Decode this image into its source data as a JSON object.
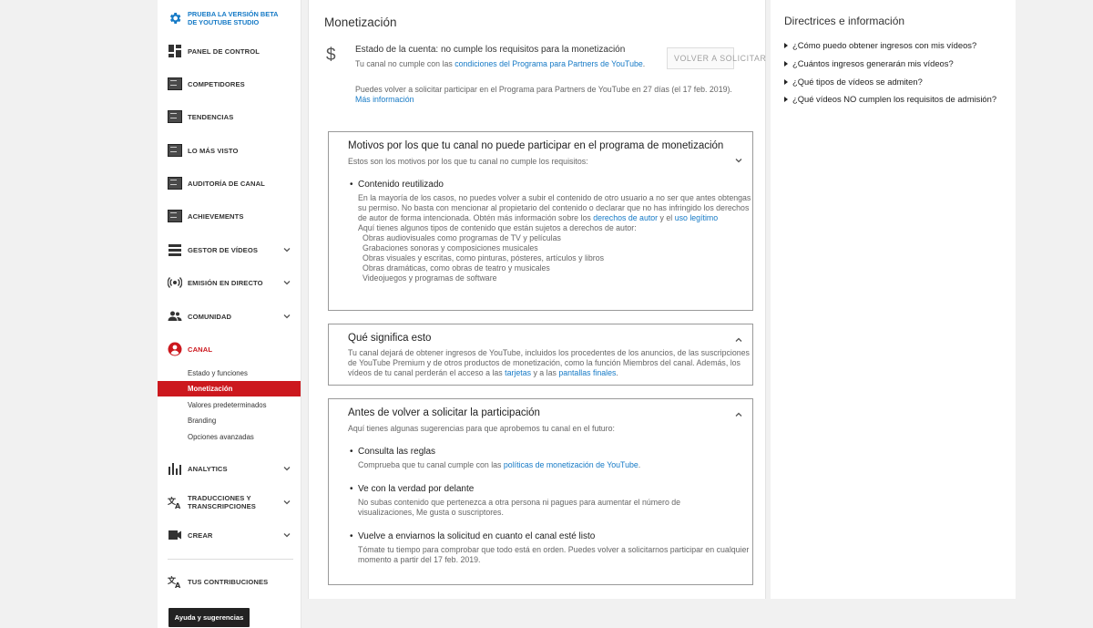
{
  "sidebar": {
    "beta_label": "PRUEBA LA VERSIÓN BETA DE YOUTUBE STUDIO",
    "items": [
      {
        "label": "PANEL DE CONTROL",
        "icon": "dashboard-icon"
      },
      {
        "label": "COMPETIDORES",
        "icon": "extension-icon"
      },
      {
        "label": "TENDENCIAS",
        "icon": "extension-icon"
      },
      {
        "label": "LO MÁS VISTO",
        "icon": "extension-icon"
      },
      {
        "label": "AUDITORÍA DE CANAL",
        "icon": "extension-icon"
      },
      {
        "label": "ACHIEVEMENTS",
        "icon": "extension-icon"
      },
      {
        "label": "GESTOR DE VÍDEOS",
        "icon": "video-manager-icon"
      },
      {
        "label": "EMISIÓN EN DIRECTO",
        "icon": "live-icon"
      },
      {
        "label": "COMUNIDAD",
        "icon": "community-icon"
      },
      {
        "label": "CANAL",
        "icon": "channel-icon"
      },
      {
        "label": "ANALYTICS",
        "icon": "analytics-icon"
      },
      {
        "label": "TRADUCCIONES Y TRANSCRIPCIONES",
        "icon": "translate-icon"
      },
      {
        "label": "CREAR",
        "icon": "create-icon"
      },
      {
        "label": "TUS CONTRIBUCIONES",
        "icon": "translate-icon"
      }
    ],
    "sub_items": [
      "Estado y funciones",
      "Monetización",
      "Valores predeterminados",
      "Branding",
      "Opciones avanzadas"
    ],
    "help_button": "Ayuda y sugerencias",
    "accent_color": "#cc181e"
  },
  "main": {
    "title": "Monetización",
    "status_title": "Estado de la cuenta: no cumple los requisitos para la monetización",
    "status_sub_prefix": "Tu canal no cumple con las ",
    "status_sub_link": "condiciones del Programa para Partners de YouTube",
    "status_sub_suffix": ".",
    "reapply_button": "VOLVER A SOLICITAR",
    "reapply_note": "Puedes volver a solicitar participar en el Programa para Partners de YouTube en 27 días (el 17 feb. 2019).",
    "more_info_link": "Más información",
    "reasons": {
      "title": "Motivos por los que tu canal no puede participar en el programa de monetización",
      "subtitle": "Estos son los motivos por los que tu canal no cumple los requisitos:",
      "item_title": "Contenido reutilizado",
      "item_text_1": "En la mayoría de los casos, no puedes volver a subir el contenido de otro usuario a no ser que antes obtengas su permiso. No basta con mencionar al propietario del contenido o declarar que no has infringido los derechos de autor de forma intencionada. Obtén más información sobre los ",
      "link_copyright": "derechos de autor",
      "item_text_and": " y el ",
      "link_fair_use": "uso legítimo",
      "list_intro": "Aquí tienes algunos tipos de contenido que están sujetos a derechos de autor:",
      "list": [
        "Obras audiovisuales como programas de TV y películas",
        "Grabaciones sonoras y composiciones musicales",
        "Obras visuales y escritas, como pinturas, pósteres, artículos y libros",
        "Obras dramáticas, como obras de teatro y musicales",
        "Videojuegos y programas de software"
      ]
    },
    "meaning": {
      "title": "Qué significa esto",
      "text": "Tu canal dejará de obtener ingresos de YouTube, incluidos los procedentes de los anuncios, de las suscripciones de YouTube Premium y de otros productos de monetización, como la función Miembros del canal. Además, los vídeos de tu canal perderán el acceso a las ",
      "link_cards": "tarjetas",
      "text_and": " y a las ",
      "link_end_screens": "pantallas finales",
      "text_end": "."
    },
    "before": {
      "title": "Antes de volver a solicitar la participación",
      "subtitle": "Aquí tienes algunas sugerencias para que aprobemos tu canal en el futuro:",
      "tips": [
        {
          "title": "Consulta las reglas",
          "text": "Comprueba que tu canal cumple con las ",
          "link": "políticas de monetización de YouTube",
          "suffix": "."
        },
        {
          "title": "Ve con la verdad por delante",
          "text": "No subas contenido que pertenezca a otra persona ni pagues para aumentar el número de visualizaciones, Me gusta o suscriptores."
        },
        {
          "title": "Vuelve a enviarnos la solicitud en cuanto el canal esté listo",
          "text": "Tómate tu tiempo para comprobar que todo está en orden. Puedes volver a solicitarnos participar en cualquier momento a partir del 17 feb. 2019."
        }
      ]
    }
  },
  "right": {
    "title": "Directrices e información",
    "faqs": [
      "¿Cómo puedo obtener ingresos con mis vídeos?",
      "¿Cuántos ingresos generarán mis vídeos?",
      "¿Qué tipos de vídeos se admiten?",
      "¿Qué vídeos NO cumplen los requisitos de admisión?"
    ]
  },
  "colors": {
    "link": "#167ac6",
    "accent": "#cc181e"
  }
}
